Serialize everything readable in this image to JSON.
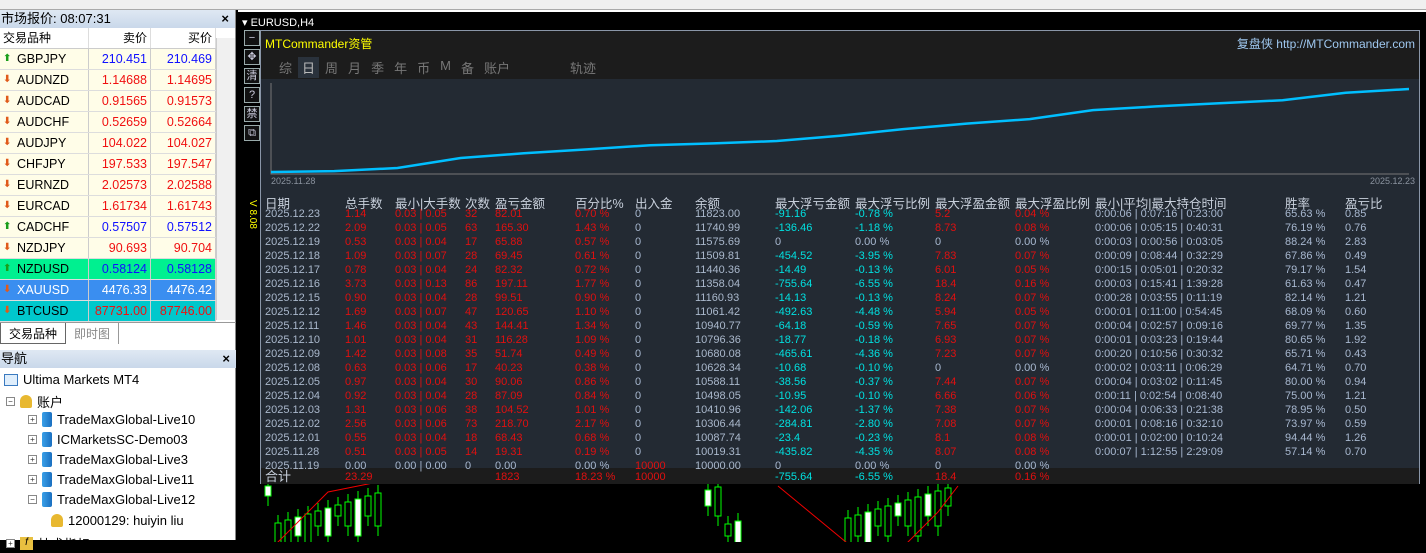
{
  "market_watch": {
    "title": "市场报价: 08:07:31",
    "col_symbol": "交易品种",
    "col_bid": "卖价",
    "col_ask": "买价",
    "rows": [
      {
        "symbol": "GBPJPY",
        "bid": "210.451",
        "ask": "210.469",
        "dir": "up"
      },
      {
        "symbol": "AUDNZD",
        "bid": "1.14688",
        "ask": "1.14695",
        "dir": "dn"
      },
      {
        "symbol": "AUDCAD",
        "bid": "0.91565",
        "ask": "0.91573",
        "dir": "dn"
      },
      {
        "symbol": "AUDCHF",
        "bid": "0.52659",
        "ask": "0.52664",
        "dir": "dn"
      },
      {
        "symbol": "AUDJPY",
        "bid": "104.022",
        "ask": "104.027",
        "dir": "dn"
      },
      {
        "symbol": "CHFJPY",
        "bid": "197.533",
        "ask": "197.547",
        "dir": "dn"
      },
      {
        "symbol": "EURNZD",
        "bid": "2.02573",
        "ask": "2.02588",
        "dir": "dn"
      },
      {
        "symbol": "EURCAD",
        "bid": "1.61734",
        "ask": "1.61743",
        "dir": "dn"
      },
      {
        "symbol": "CADCHF",
        "bid": "0.57507",
        "ask": "0.57512",
        "dir": "up"
      },
      {
        "symbol": "NZDJPY",
        "bid": "90.693",
        "ask": "90.704",
        "dir": "dn"
      },
      {
        "symbol": "NZDUSD",
        "bid": "0.58124",
        "ask": "0.58128",
        "dir": "up",
        "bg": "#00f090"
      },
      {
        "symbol": "XAUUSD",
        "bid": "4476.33",
        "ask": "4476.42",
        "dir": "dn",
        "bg": "#3a8ef0",
        "fg": "#ffffff"
      },
      {
        "symbol": "BTCUSD",
        "bid": "87731.00",
        "ask": "87746.00",
        "dir": "dn",
        "bg": "#00c8cc"
      }
    ],
    "tabs": [
      "交易品种",
      "即时图"
    ]
  },
  "navigator": {
    "title": "导航",
    "root": "Ultima Markets MT4",
    "accounts": "账户",
    "servers": [
      "TradeMaxGlobal-Live10",
      "ICMarketsSC-Demo03",
      "TradeMaxGlobal-Live3",
      "TradeMaxGlobal-Live11",
      "TradeMaxGlobal-Live12"
    ],
    "account": "12000129: huiyin liu",
    "indicators": "技术指标"
  },
  "chart": {
    "title": "EURUSD,H4",
    "version": "V 8.08",
    "side_buttons": [
      "−",
      "✥",
      "清",
      "?",
      "禁",
      "⧉"
    ]
  },
  "panel": {
    "title": "MTCommander资管",
    "brand": "复盘侠",
    "link": "http://MTCommander.com",
    "tabs": [
      "综",
      "日",
      "周",
      "月",
      "季",
      "年",
      "币",
      "M",
      "备",
      "账户",
      "轨迹"
    ],
    "active_tab": "日",
    "eq_start_label": "2025.11.28",
    "eq_end_label": "2025.12.23",
    "headers": [
      "日期",
      "总手数",
      "最小|大手数",
      "次数",
      "盈亏金额",
      "百分比%",
      "出入金",
      "余额",
      "最大浮亏金额",
      "最大浮亏比例",
      "最大浮盈金额",
      "最大浮盈比例",
      "最小|平均|最大持仓时间",
      "胜率",
      "盈亏比"
    ],
    "rows": [
      [
        "2025.12.23",
        "1.14",
        "0.03 | 0.05",
        "32",
        "82.01",
        "0.70 %",
        "0",
        "11823.00",
        "-91.16",
        "-0.78 %",
        "5.2",
        "0.04 %",
        "0:00:06 | 0:07:16 | 0:23:00",
        "65.63 %",
        "0.85"
      ],
      [
        "2025.12.22",
        "2.09",
        "0.03 | 0.05",
        "63",
        "165.30",
        "1.43 %",
        "0",
        "11740.99",
        "-136.46",
        "-1.18 %",
        "8.73",
        "0.08 %",
        "0:00:06 | 0:05:15 | 0:40:31",
        "76.19 %",
        "0.76"
      ],
      [
        "2025.12.19",
        "0.53",
        "0.03 | 0.04",
        "17",
        "65.88",
        "0.57 %",
        "0",
        "11575.69",
        "0",
        "0.00 %",
        "0",
        "0.00 %",
        "0:00:03 | 0:00:56 | 0:03:05",
        "88.24 %",
        "2.83"
      ],
      [
        "2025.12.18",
        "1.09",
        "0.03 | 0.07",
        "28",
        "69.45",
        "0.61 %",
        "0",
        "11509.81",
        "-454.52",
        "-3.95 %",
        "7.83",
        "0.07 %",
        "0:00:09 | 0:08:44 | 0:32:29",
        "67.86 %",
        "0.49"
      ],
      [
        "2025.12.17",
        "0.78",
        "0.03 | 0.04",
        "24",
        "82.32",
        "0.72 %",
        "0",
        "11440.36",
        "-14.49",
        "-0.13 %",
        "6.01",
        "0.05 %",
        "0:00:15 | 0:05:01 | 0:20:32",
        "79.17 %",
        "1.54"
      ],
      [
        "2025.12.16",
        "3.73",
        "0.03 | 0.13",
        "86",
        "197.11",
        "1.77 %",
        "0",
        "11358.04",
        "-755.64",
        "-6.55 %",
        "18.4",
        "0.16 %",
        "0:00:03 | 0:15:41 | 1:39:28",
        "61.63 %",
        "0.47"
      ],
      [
        "2025.12.15",
        "0.90",
        "0.03 | 0.04",
        "28",
        "99.51",
        "0.90 %",
        "0",
        "11160.93",
        "-14.13",
        "-0.13 %",
        "8.24",
        "0.07 %",
        "0:00:28 | 0:03:55 | 0:11:19",
        "82.14 %",
        "1.21"
      ],
      [
        "2025.12.12",
        "1.69",
        "0.03 | 0.07",
        "47",
        "120.65",
        "1.10 %",
        "0",
        "11061.42",
        "-492.63",
        "-4.48 %",
        "5.94",
        "0.05 %",
        "0:00:01 | 0:11:00 | 0:54:45",
        "68.09 %",
        "0.60"
      ],
      [
        "2025.12.11",
        "1.46",
        "0.03 | 0.04",
        "43",
        "144.41",
        "1.34 %",
        "0",
        "10940.77",
        "-64.18",
        "-0.59 %",
        "7.65",
        "0.07 %",
        "0:00:04 | 0:02:57 | 0:09:16",
        "69.77 %",
        "1.35"
      ],
      [
        "2025.12.10",
        "1.01",
        "0.03 | 0.04",
        "31",
        "116.28",
        "1.09 %",
        "0",
        "10796.36",
        "-18.77",
        "-0.18 %",
        "6.93",
        "0.07 %",
        "0:00:01 | 0:03:23 | 0:19:44",
        "80.65 %",
        "1.92"
      ],
      [
        "2025.12.09",
        "1.42",
        "0.03 | 0.08",
        "35",
        "51.74",
        "0.49 %",
        "0",
        "10680.08",
        "-465.61",
        "-4.36 %",
        "7.23",
        "0.07 %",
        "0:00:20 | 0:10:56 | 0:30:32",
        "65.71 %",
        "0.43"
      ],
      [
        "2025.12.08",
        "0.63",
        "0.03 | 0.06",
        "17",
        "40.23",
        "0.38 %",
        "0",
        "10628.34",
        "-10.68",
        "-0.10 %",
        "0",
        "0.00 %",
        "0:00:02 | 0:03:11 | 0:06:29",
        "64.71 %",
        "0.70"
      ],
      [
        "2025.12.05",
        "0.97",
        "0.03 | 0.04",
        "30",
        "90.06",
        "0.86 %",
        "0",
        "10588.11",
        "-38.56",
        "-0.37 %",
        "7.44",
        "0.07 %",
        "0:00:04 | 0:03:02 | 0:11:45",
        "80.00 %",
        "0.94"
      ],
      [
        "2025.12.04",
        "0.92",
        "0.03 | 0.04",
        "28",
        "87.09",
        "0.84 %",
        "0",
        "10498.05",
        "-10.95",
        "-0.10 %",
        "6.66",
        "0.06 %",
        "0:00:11 | 0:02:54 | 0:08:40",
        "75.00 %",
        "1.21"
      ],
      [
        "2025.12.03",
        "1.31",
        "0.03 | 0.06",
        "38",
        "104.52",
        "1.01 %",
        "0",
        "10410.96",
        "-142.06",
        "-1.37 %",
        "7.38",
        "0.07 %",
        "0:00:04 | 0:06:33 | 0:21:38",
        "78.95 %",
        "0.50"
      ],
      [
        "2025.12.02",
        "2.56",
        "0.03 | 0.06",
        "73",
        "218.70",
        "2.17 %",
        "0",
        "10306.44",
        "-284.81",
        "-2.80 %",
        "7.08",
        "0.07 %",
        "0:00:01 | 0:08:16 | 0:32:10",
        "73.97 %",
        "0.59"
      ],
      [
        "2025.12.01",
        "0.55",
        "0.03 | 0.04",
        "18",
        "68.43",
        "0.68 %",
        "0",
        "10087.74",
        "-23.4",
        "-0.23 %",
        "8.1",
        "0.08 %",
        "0:00:01 | 0:02:00 | 0:10:24",
        "94.44 %",
        "1.26"
      ],
      [
        "2025.11.28",
        "0.51",
        "0.03 | 0.05",
        "14",
        "19.31",
        "0.19 %",
        "0",
        "10019.31",
        "-435.82",
        "-4.35 %",
        "8.07",
        "0.08 %",
        "0:00:07 | 1:12:55 | 2:29:09",
        "57.14 %",
        "0.70"
      ],
      [
        "2025.11.19",
        "0.00",
        "0.00 | 0.00",
        "0",
        "0.00",
        "0.00 %",
        "10000",
        "10000.00",
        "0",
        "0.00 %",
        "0",
        "0.00 %",
        "",
        "",
        ""
      ]
    ],
    "total": [
      "合计",
      "23.29",
      "",
      "",
      "1823",
      "18.23 %",
      "10000",
      "",
      "-755.64",
      "-6.55 %",
      "18.4",
      "0.16 %",
      "",
      "",
      ""
    ],
    "balance_series": [
      10000.0,
      10019.31,
      10087.74,
      10306.44,
      10410.96,
      10498.05,
      10588.11,
      10628.34,
      10680.08,
      10796.36,
      10940.77,
      11061.42,
      11160.93,
      11358.04,
      11440.36,
      11509.81,
      11575.69,
      11740.99,
      11823.0
    ]
  }
}
